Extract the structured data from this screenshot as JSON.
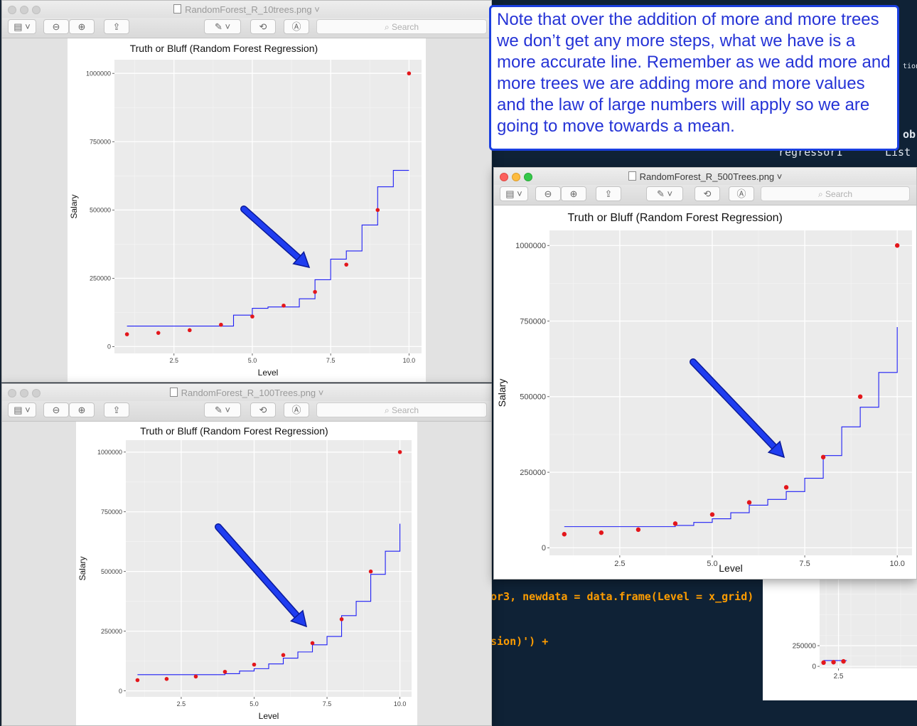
{
  "windows": {
    "w10": {
      "title": "RandomForest_R_10trees.png"
    },
    "w100": {
      "title": "RandomForest_R_100Trees.png"
    },
    "w500": {
      "title": "RandomForest_R_500Trees.png"
    }
  },
  "toolbar": {
    "search_placeholder": "Search"
  },
  "callout": {
    "text": "Note that over the addition of more and more trees we don’t get any more steps, what we have is a more accurate line. Remember as we add more and more trees we are adding more and more values and the law of large numbers will apply so we are going to move towards a mean."
  },
  "background": {
    "code_line_1": "or3, newdata = data.frame(Level = x_grid)",
    "code_line_2": "sion)') +",
    "env_1": "ob",
    "env_2": "regressor1",
    "env_3": "List",
    "env_4": "tions"
  },
  "colors": {
    "points": "#e3161b",
    "line": "#1f1ff5",
    "panel": "#ebebeb",
    "callout_border": "#1a3fe0",
    "callout_text": "#2533d6"
  },
  "chart_data": [
    {
      "type": "scatter",
      "id": "rf10",
      "title": "Truth or Bluff (Random Forest Regression)",
      "xlabel": "Level",
      "ylabel": "Salary",
      "xlim": [
        0.6,
        10.4
      ],
      "ylim": [
        -25000,
        1050000
      ],
      "xticks": [
        2.5,
        5.0,
        7.5,
        10.0
      ],
      "xtick_labels": [
        "2.5",
        "5.0",
        "7.5",
        "10.0"
      ],
      "yticks": [
        0,
        250000,
        500000,
        750000,
        1000000
      ],
      "ytick_labels": [
        "0",
        "250000",
        "500000",
        "750000",
        "1000000"
      ],
      "points": {
        "x": [
          1,
          2,
          3,
          4,
          5,
          6,
          7,
          8,
          9,
          10
        ],
        "y": [
          45000,
          50000,
          60000,
          80000,
          110000,
          150000,
          200000,
          300000,
          500000,
          1000000
        ]
      },
      "step_line": {
        "x": [
          1.0,
          3.0,
          4.4,
          5.0,
          5.5,
          6.5,
          7.0,
          7.5,
          8.0,
          8.5,
          9.0,
          9.5,
          10.0
        ],
        "y": [
          75000,
          75000,
          115000,
          140000,
          145000,
          175000,
          245000,
          320000,
          350000,
          445000,
          585000,
          645000,
          645000
        ]
      }
    },
    {
      "type": "scatter",
      "id": "rf100",
      "title": "Truth or Bluff (Random Forest Regression)",
      "xlabel": "Level",
      "ylabel": "Salary",
      "xlim": [
        0.6,
        10.4
      ],
      "ylim": [
        -25000,
        1050000
      ],
      "xticks": [
        2.5,
        5.0,
        7.5,
        10.0
      ],
      "xtick_labels": [
        "2.5",
        "5.0",
        "7.5",
        "10.0"
      ],
      "yticks": [
        0,
        250000,
        500000,
        750000,
        1000000
      ],
      "ytick_labels": [
        "0",
        "250000",
        "500000",
        "750000",
        "1000000"
      ],
      "points": {
        "x": [
          1,
          2,
          3,
          4,
          5,
          6,
          7,
          8,
          9,
          10
        ],
        "y": [
          45000,
          50000,
          60000,
          80000,
          110000,
          150000,
          200000,
          300000,
          500000,
          1000000
        ]
      },
      "step_line": {
        "x": [
          1.0,
          3.0,
          4.0,
          4.5,
          5.0,
          5.5,
          6.0,
          6.5,
          7.0,
          7.5,
          8.0,
          8.5,
          9.0,
          9.5,
          10.0
        ],
        "y": [
          68000,
          68000,
          72000,
          83000,
          93000,
          113000,
          137000,
          163000,
          193000,
          228000,
          315000,
          375000,
          488000,
          585000,
          700000
        ]
      }
    },
    {
      "type": "scatter",
      "id": "rf500",
      "title": "Truth or Bluff (Random Forest Regression)",
      "xlabel": "Level",
      "ylabel": "Salary",
      "xlim": [
        0.6,
        10.4
      ],
      "ylim": [
        -25000,
        1050000
      ],
      "xticks": [
        2.5,
        5.0,
        7.5,
        10.0
      ],
      "xtick_labels": [
        "2.5",
        "5.0",
        "7.5",
        "10.0"
      ],
      "yticks": [
        0,
        250000,
        500000,
        750000,
        1000000
      ],
      "ytick_labels": [
        "0",
        "250000",
        "500000",
        "750000",
        "1000000"
      ],
      "points": {
        "x": [
          1,
          2,
          3,
          4,
          5,
          6,
          7,
          8,
          9,
          10
        ],
        "y": [
          45000,
          50000,
          60000,
          80000,
          110000,
          150000,
          200000,
          300000,
          500000,
          1000000
        ]
      },
      "step_line": {
        "x": [
          1.0,
          3.0,
          4.0,
          4.5,
          5.0,
          5.5,
          6.0,
          6.5,
          7.0,
          7.5,
          8.0,
          8.5,
          9.0,
          9.5,
          10.0
        ],
        "y": [
          70000,
          70000,
          74000,
          84000,
          96000,
          116000,
          141000,
          160000,
          186000,
          230000,
          305000,
          400000,
          465000,
          580000,
          730000
        ]
      }
    },
    {
      "type": "scatter",
      "id": "bgplot",
      "yticks": [
        0,
        250000
      ],
      "ytick_labels": [
        "0",
        "250000"
      ],
      "xticks": [
        2.5
      ],
      "xtick_labels": [
        "2.5"
      ],
      "points": {
        "x": [
          1,
          2,
          3
        ],
        "y": [
          45000,
          50000,
          60000
        ]
      },
      "step_line": {
        "x": [
          1.0,
          3.0,
          3.3
        ],
        "y": [
          70000,
          70000,
          72000
        ]
      }
    }
  ]
}
